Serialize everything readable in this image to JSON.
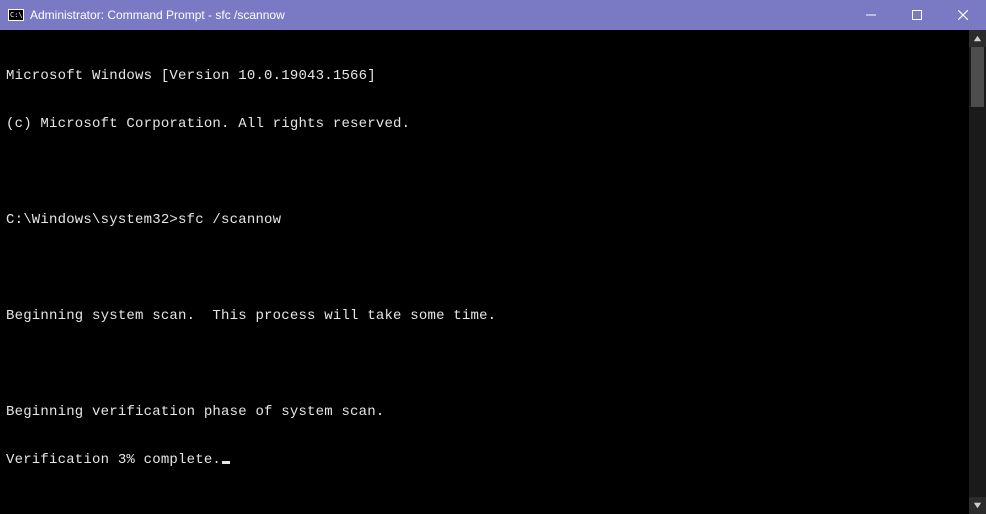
{
  "window": {
    "title": "Administrator: Command Prompt - sfc  /scannow"
  },
  "terminal": {
    "lines": [
      "Microsoft Windows [Version 10.0.19043.1566]",
      "(c) Microsoft Corporation. All rights reserved.",
      "",
      "C:\\Windows\\system32>sfc /scannow",
      "",
      "Beginning system scan.  This process will take some time.",
      "",
      "Beginning verification phase of system scan.",
      "Verification 3% complete."
    ]
  }
}
